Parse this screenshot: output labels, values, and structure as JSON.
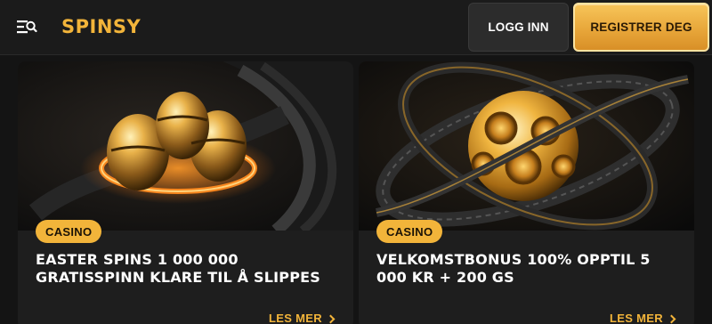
{
  "header": {
    "logo_text": "SPINSY",
    "login_label": "LOGG INN",
    "register_label": "REGISTRER DEG"
  },
  "promos": [
    {
      "category": "CASINO",
      "title": "EASTER SPINS 1 000 000 GRATISSPINN KLARE TIL Å SLIPPES",
      "link_label": "LES MER"
    },
    {
      "category": "CASINO",
      "title": "VELKOMSTBONUS 100% OPPTIL 5 000 KR + 200 GS",
      "link_label": "LES MER"
    }
  ],
  "colors": {
    "accent": "#f2b43a",
    "background": "#141414",
    "card": "#1e1e1e"
  },
  "icons": {
    "menu": "menu-search-icon",
    "link": "chevron-right-icon"
  }
}
